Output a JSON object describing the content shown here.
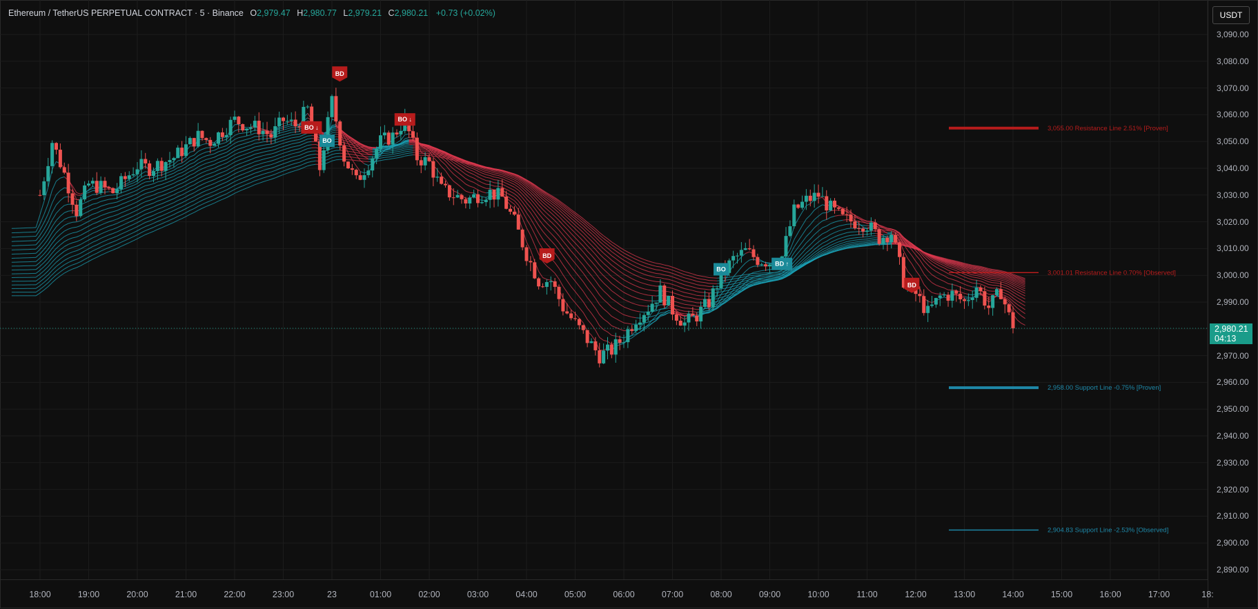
{
  "header": {
    "symbol": "Ethereum / TetherUS PERPETUAL CONTRACT · 5 · Binance",
    "o_label": "O",
    "o_value": "2,979.47",
    "h_label": "H",
    "h_value": "2,980.77",
    "l_label": "L",
    "l_value": "2,979.21",
    "c_label": "C",
    "c_value": "2,980.21",
    "change": "+0.73 (+0.02%)"
  },
  "currency_button": "USDT",
  "last_price": {
    "price": "2,980.21",
    "countdown": "04:13",
    "value": 2980.21,
    "color": "#1a9c8a"
  },
  "colors": {
    "bull": "#26a69a",
    "bear": "#ef5350",
    "ribbon_up": "#1ba3b8",
    "ribbon_down": "#e0394f",
    "resistance": "#b71c1c",
    "support": "#1e88a8"
  },
  "price_axis": {
    "labels": [
      "3,090.00",
      "3,080.00",
      "3,070.00",
      "3,060.00",
      "3,050.00",
      "3,040.00",
      "3,030.00",
      "3,020.00",
      "3,010.00",
      "3,000.00",
      "2,990.00",
      "2,970.00",
      "2,960.00",
      "2,950.00",
      "2,940.00",
      "2,930.00",
      "2,920.00",
      "2,910.00",
      "2,900.00",
      "2,890.00"
    ],
    "values": [
      3090,
      3080,
      3070,
      3060,
      3050,
      3040,
      3030,
      3020,
      3010,
      3000,
      2990,
      2970,
      2960,
      2950,
      2940,
      2930,
      2920,
      2910,
      2900,
      2890
    ]
  },
  "time_axis": {
    "labels": [
      "18:00",
      "19:00",
      "20:00",
      "21:00",
      "22:00",
      "23:00",
      "23",
      "01:00",
      "02:00",
      "03:00",
      "04:00",
      "05:00",
      "06:00",
      "07:00",
      "08:00",
      "09:00",
      "10:00",
      "11:00",
      "12:00",
      "13:00",
      "14:00",
      "15:00",
      "16:00",
      "17:00",
      "18:"
    ],
    "hours": [
      0,
      1,
      2,
      3,
      4,
      5,
      6,
      7,
      8,
      9,
      10,
      11,
      12,
      13,
      14,
      15,
      16,
      17,
      18,
      19,
      20,
      21,
      22,
      23,
      24
    ]
  },
  "levels": [
    {
      "price": 3055.0,
      "label": "3,055.00 Resistance Line 2.51% [Proven]",
      "kind": "resistance",
      "style": "proven"
    },
    {
      "price": 3001.01,
      "label": "3,001.01 Resistance Line 0.70% [Observed]",
      "kind": "resistance",
      "style": "observed"
    },
    {
      "price": 2958.0,
      "label": "2,958.00 Support Line -0.75% [Proven]",
      "kind": "support",
      "style": "proven"
    },
    {
      "price": 2904.83,
      "label": "2,904.83 Support Line -2.53% [Observed]",
      "kind": "support",
      "style": "observed"
    }
  ],
  "signals": [
    {
      "text": "BD",
      "hour": 6.16,
      "price": 3075,
      "kind": "bear",
      "shape": "flag"
    },
    {
      "text": "BO ↓",
      "hour": 7.5,
      "price": 3058,
      "kind": "bear",
      "shape": "box"
    },
    {
      "text": "BO ↓",
      "hour": 5.58,
      "price": 3055,
      "kind": "bear",
      "shape": "box"
    },
    {
      "text": "BO",
      "hour": 5.9,
      "price": 3050,
      "kind": "bull",
      "shape": "box"
    },
    {
      "text": "BD",
      "hour": 10.42,
      "price": 3007,
      "kind": "bear",
      "shape": "flag"
    },
    {
      "text": "BO",
      "hour": 14.0,
      "price": 3002,
      "kind": "bull",
      "shape": "box"
    },
    {
      "text": "BD ↑",
      "hour": 15.25,
      "price": 3004,
      "kind": "bull",
      "shape": "box"
    },
    {
      "text": "BD",
      "hour": 17.92,
      "price": 2996,
      "kind": "bear",
      "shape": "flag"
    }
  ],
  "chart_data": {
    "type": "candlestick",
    "bar_interval_minutes": 5,
    "x_unit": "hours after 18:00",
    "closes": [
      [
        0.0,
        3030
      ],
      [
        0.25,
        3050
      ],
      [
        0.5,
        3038
      ],
      [
        0.75,
        3024
      ],
      [
        1.0,
        3034
      ],
      [
        1.25,
        3033
      ],
      [
        1.5,
        3031
      ],
      [
        1.75,
        3036
      ],
      [
        2.0,
        3041
      ],
      [
        2.25,
        3040
      ],
      [
        2.5,
        3042
      ],
      [
        2.75,
        3044
      ],
      [
        3.0,
        3048
      ],
      [
        3.25,
        3052
      ],
      [
        3.5,
        3050
      ],
      [
        3.75,
        3054
      ],
      [
        4.0,
        3058
      ],
      [
        4.25,
        3056
      ],
      [
        4.5,
        3055
      ],
      [
        4.75,
        3052
      ],
      [
        5.0,
        3058
      ],
      [
        5.25,
        3056
      ],
      [
        5.5,
        3062
      ],
      [
        5.75,
        3040
      ],
      [
        6.0,
        3065
      ],
      [
        6.25,
        3044
      ],
      [
        6.5,
        3035
      ],
      [
        6.75,
        3042
      ],
      [
        7.0,
        3050
      ],
      [
        7.25,
        3052
      ],
      [
        7.5,
        3058
      ],
      [
        7.75,
        3044
      ],
      [
        8.0,
        3042
      ],
      [
        8.25,
        3032
      ],
      [
        8.5,
        3030
      ],
      [
        8.75,
        3028
      ],
      [
        9.0,
        3030
      ],
      [
        9.25,
        3031
      ],
      [
        9.5,
        3029
      ],
      [
        9.75,
        3020
      ],
      [
        10.0,
        3008
      ],
      [
        10.25,
        2998
      ],
      [
        10.5,
        2998
      ],
      [
        10.75,
        2988
      ],
      [
        11.0,
        2982
      ],
      [
        11.25,
        2976
      ],
      [
        11.5,
        2970
      ],
      [
        11.75,
        2972
      ],
      [
        12.0,
        2977
      ],
      [
        12.25,
        2984
      ],
      [
        12.5,
        2988
      ],
      [
        12.75,
        2994
      ],
      [
        13.0,
        2987
      ],
      [
        13.25,
        2982
      ],
      [
        13.5,
        2985
      ],
      [
        13.75,
        2990
      ],
      [
        14.0,
        3000
      ],
      [
        14.25,
        3006
      ],
      [
        14.5,
        3009
      ],
      [
        14.75,
        3006
      ],
      [
        15.0,
        3005
      ],
      [
        15.25,
        3007
      ],
      [
        15.5,
        3024
      ],
      [
        15.75,
        3028
      ],
      [
        16.0,
        3030
      ],
      [
        16.25,
        3025
      ],
      [
        16.5,
        3021
      ],
      [
        16.75,
        3020
      ],
      [
        17.0,
        3019
      ],
      [
        17.25,
        3014
      ],
      [
        17.5,
        3016
      ],
      [
        17.75,
        2998
      ],
      [
        18.0,
        2993
      ],
      [
        18.25,
        2986
      ],
      [
        18.5,
        2992
      ],
      [
        18.75,
        2993
      ],
      [
        19.0,
        2990
      ],
      [
        19.25,
        2996
      ],
      [
        19.5,
        2988
      ],
      [
        19.75,
        2994
      ],
      [
        20.0,
        2980
      ]
    ],
    "ylim": [
      2884,
      3096
    ],
    "xlim": [
      -0.6,
      24.3
    ],
    "last_close": 2980.21
  }
}
